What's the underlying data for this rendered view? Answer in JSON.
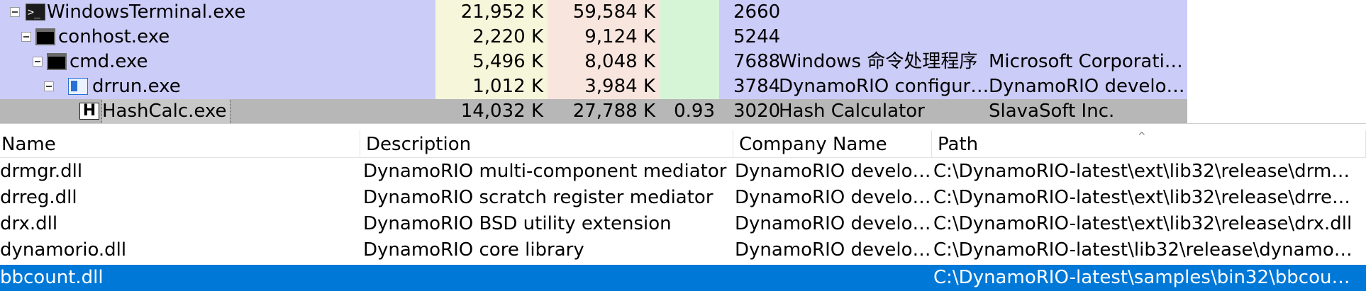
{
  "processes": [
    {
      "name": "WindowsTerminal.exe",
      "icon": "terminal-icon",
      "private_bytes": "21,952 K",
      "working_set": "59,584 K",
      "cpu": "",
      "pid": "2660",
      "description": "",
      "company": "",
      "selected": false
    },
    {
      "name": "conhost.exe",
      "icon": "console-icon",
      "private_bytes": "2,220 K",
      "working_set": "9,124 K",
      "cpu": "",
      "pid": "5244",
      "description": "",
      "company": "",
      "selected": false
    },
    {
      "name": "cmd.exe",
      "icon": "console-icon",
      "private_bytes": "5,496 K",
      "working_set": "8,048 K",
      "cpu": "",
      "pid": "7688",
      "description": "Windows 命令处理程序",
      "company": "Microsoft Corporati…",
      "selected": false
    },
    {
      "name": "drrun.exe",
      "icon": "dynamorio-icon",
      "private_bytes": "1,012 K",
      "working_set": "3,984 K",
      "cpu": "",
      "pid": "3784",
      "description": "DynamoRIO configur…",
      "company": "DynamoRIO develo…",
      "selected": false
    },
    {
      "name": "HashCalc.exe",
      "icon": "hashcalc-icon",
      "private_bytes": "14,032 K",
      "working_set": "27,788 K",
      "cpu": "0.93",
      "pid": "3020",
      "description": "Hash Calculator",
      "company": "SlavaSoft Inc.",
      "selected": true
    }
  ],
  "module_columns": {
    "name": "Name",
    "description": "Description",
    "company": "Company Name",
    "path": "Path",
    "sort_indicator": "^"
  },
  "modules": [
    {
      "name": "drmgr.dll",
      "description": "DynamoRIO multi-component mediator",
      "company": "DynamoRIO develo…",
      "path": "C:\\DynamoRIO-latest\\ext\\lib32\\release\\drm…"
    },
    {
      "name": "drreg.dll",
      "description": "DynamoRIO scratch register mediator",
      "company": "DynamoRIO develo…",
      "path": "C:\\DynamoRIO-latest\\ext\\lib32\\release\\drre…"
    },
    {
      "name": "drx.dll",
      "description": "DynamoRIO BSD utility extension",
      "company": "DynamoRIO develo…",
      "path": "C:\\DynamoRIO-latest\\ext\\lib32\\release\\drx.dll"
    },
    {
      "name": "dynamorio.dll",
      "description": "DynamoRIO core library",
      "company": "DynamoRIO develo…",
      "path": "C:\\DynamoRIO-latest\\lib32\\release\\dynamo…"
    },
    {
      "name": "bbcount.dll",
      "description": "",
      "company": "",
      "path": "C:\\DynamoRIO-latest\\samples\\bin32\\bbcou…"
    }
  ],
  "colors": {
    "process_row_bg": "#ccccf8",
    "selected_process_bg": "#b7b7b7",
    "selected_module_bg": "#0078d7"
  }
}
